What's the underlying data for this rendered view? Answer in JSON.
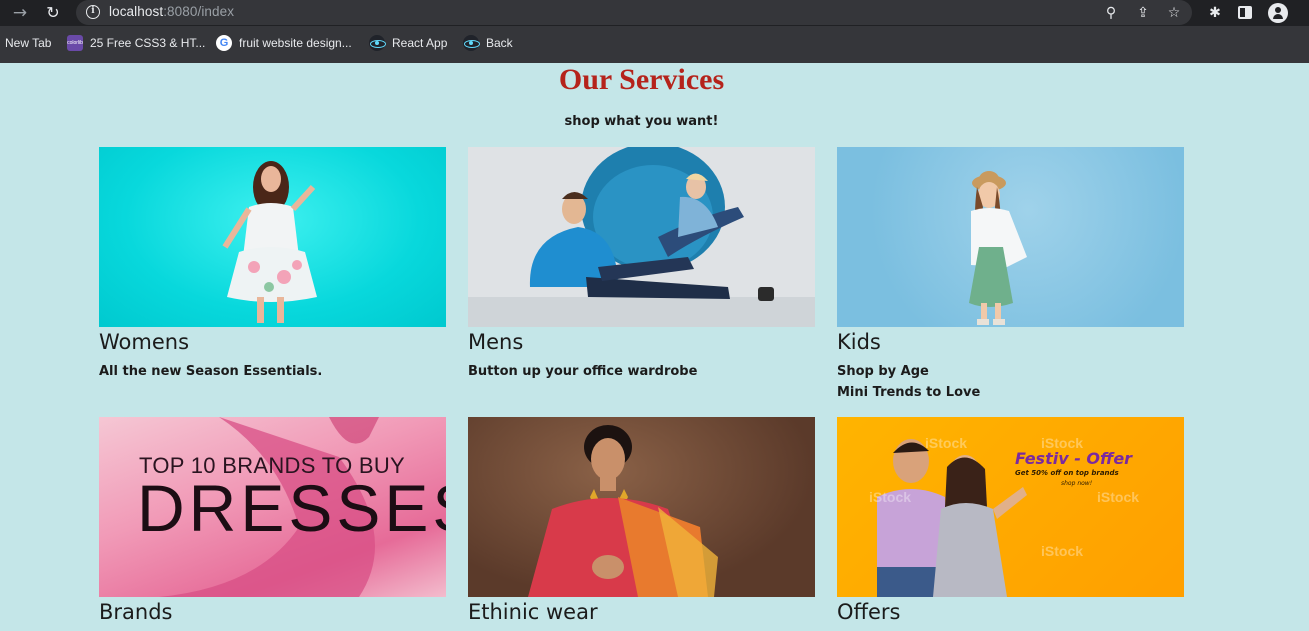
{
  "browser": {
    "url_host": "localhost",
    "url_path": ":8080/index",
    "bookmarks": [
      {
        "label": "New Tab"
      },
      {
        "label": "25 Free CSS3 & HT..."
      },
      {
        "label": "fruit website design..."
      },
      {
        "label": "React App"
      },
      {
        "label": "Back"
      }
    ],
    "favicon_colorlib_text": "colorlib"
  },
  "page": {
    "title": "Our Services",
    "subtitle": "shop what you want!"
  },
  "cards": [
    {
      "title": "Womens",
      "lines": [
        "All the new Season Essentials."
      ]
    },
    {
      "title": "Mens",
      "lines": [
        "Button up your office wardrobe"
      ]
    },
    {
      "title": "Kids",
      "lines": [
        "Shop by Age",
        "Mini Trends to Love"
      ]
    },
    {
      "title": "Brands",
      "image_text": [
        "TOP 10 BRANDS TO BUY",
        "DRESSES"
      ]
    },
    {
      "title": "Ethinic wear"
    },
    {
      "title": "Offers",
      "image_text": [
        "Festiv - Offer",
        "Get 50% off on top brands",
        "shop now!",
        "iStock"
      ]
    }
  ],
  "colors": {
    "page_bg": "#c4e6e8",
    "title": "#b5231b",
    "text": "#1b1b1b",
    "chrome_bg": "#35363a"
  }
}
